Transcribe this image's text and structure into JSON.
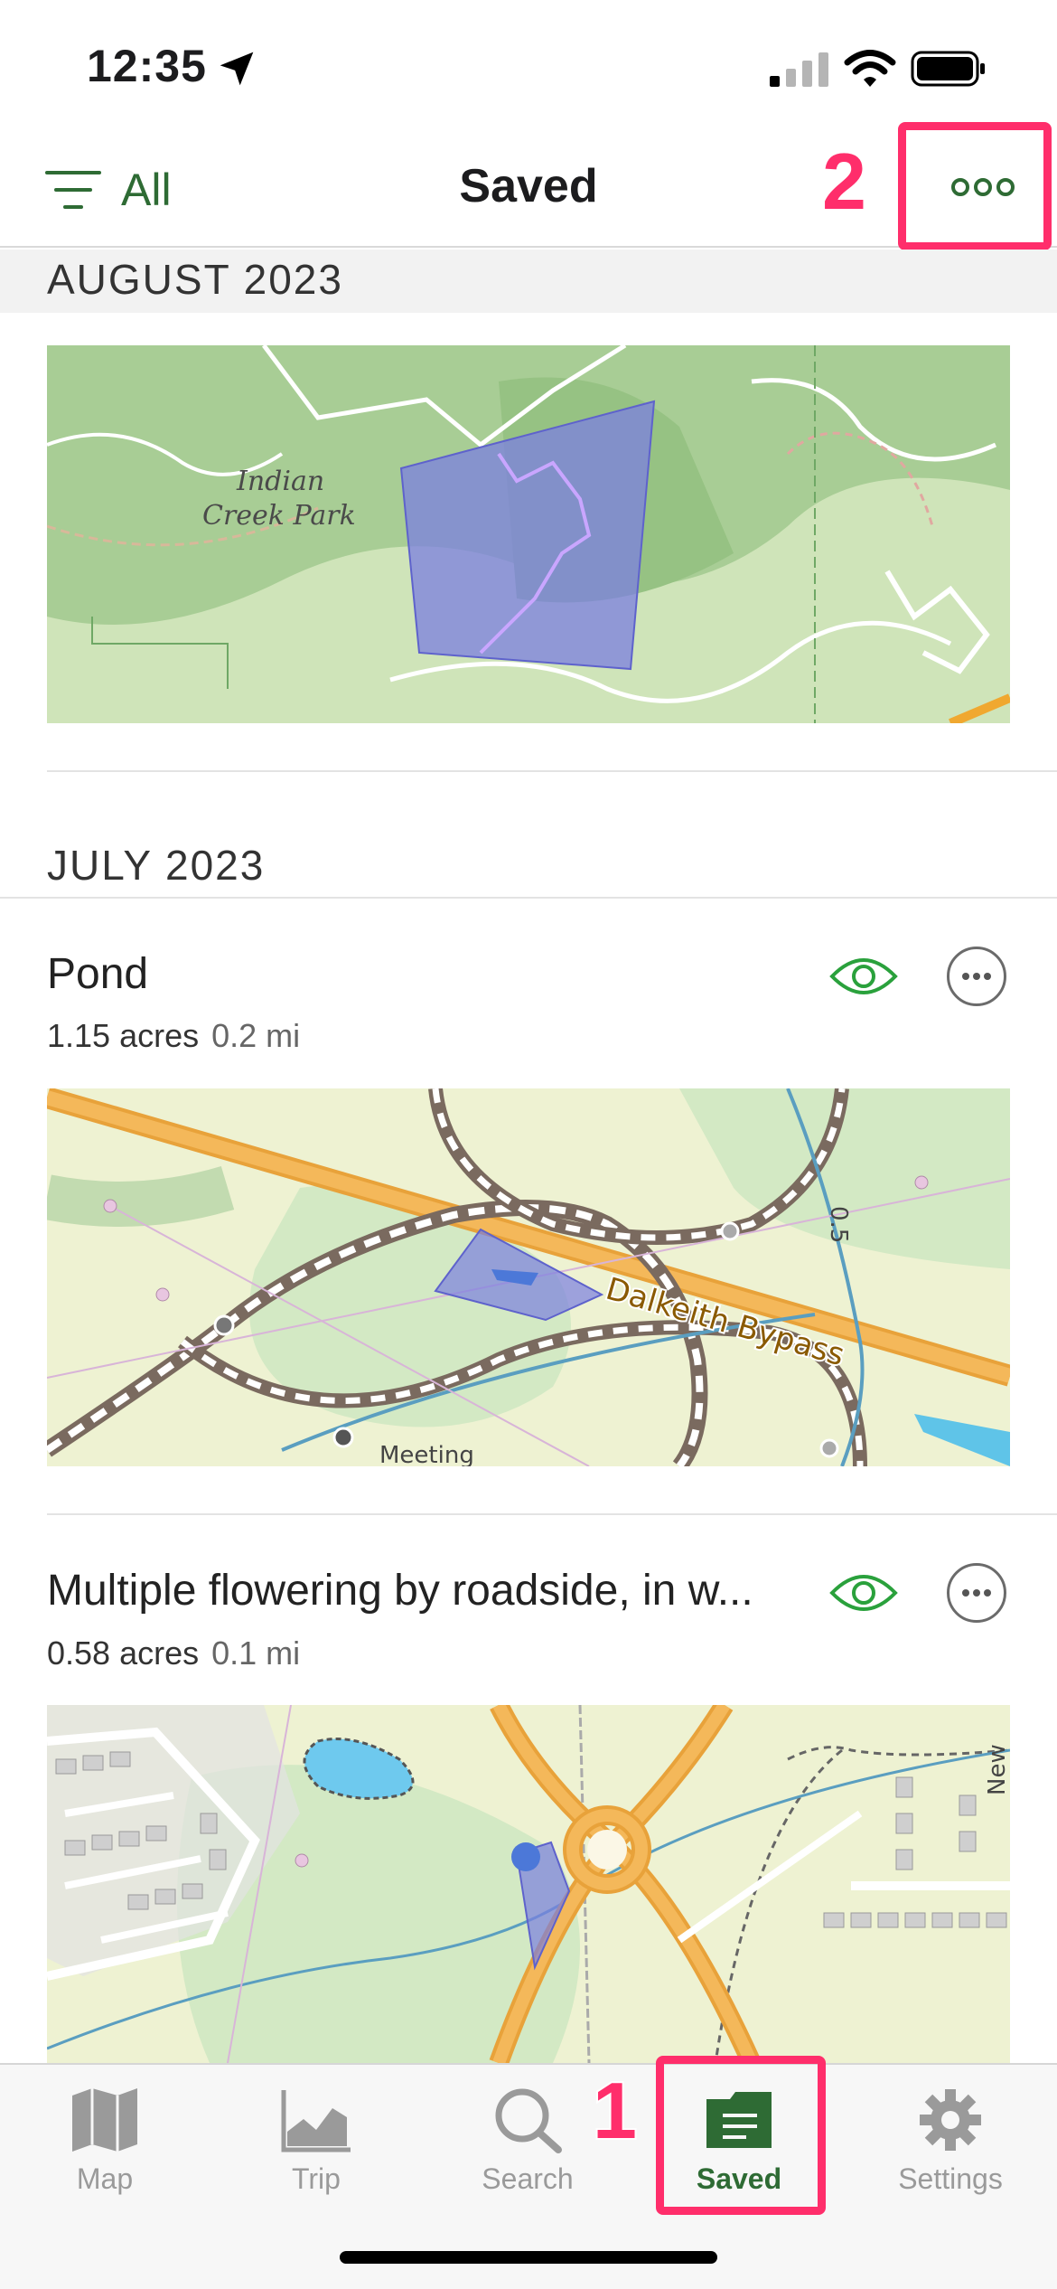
{
  "status": {
    "time": "12:35"
  },
  "nav": {
    "filter_label": "All",
    "title": "Saved"
  },
  "annotations": {
    "more": "2",
    "saved": "1"
  },
  "sections": [
    {
      "header": "AUGUST 2023"
    },
    {
      "header": "JULY 2023"
    }
  ],
  "items": [
    {
      "map_labels": [
        "Indian",
        "Creek Park"
      ]
    },
    {
      "title": "Pond",
      "area": "1.15 acres",
      "distance": "0.2 mi",
      "map_labels": [
        "Dalkeith Bypass",
        "0.5",
        "Meeting"
      ]
    },
    {
      "title": "Multiple flowering by roadside, in w...",
      "area": "0.58 acres",
      "distance": "0.1 mi",
      "map_labels": [
        "New"
      ]
    }
  ],
  "tabs": [
    {
      "label": "Map",
      "icon": "map-icon"
    },
    {
      "label": "Trip",
      "icon": "chart-icon"
    },
    {
      "label": "Search",
      "icon": "search-icon"
    },
    {
      "label": "Saved",
      "icon": "saved-icon",
      "active": true
    },
    {
      "label": "Settings",
      "icon": "gear-icon"
    }
  ],
  "colors": {
    "accent": "#2e6b34",
    "highlight": "#ff2e6b",
    "polygon": "#7b7fe0"
  }
}
